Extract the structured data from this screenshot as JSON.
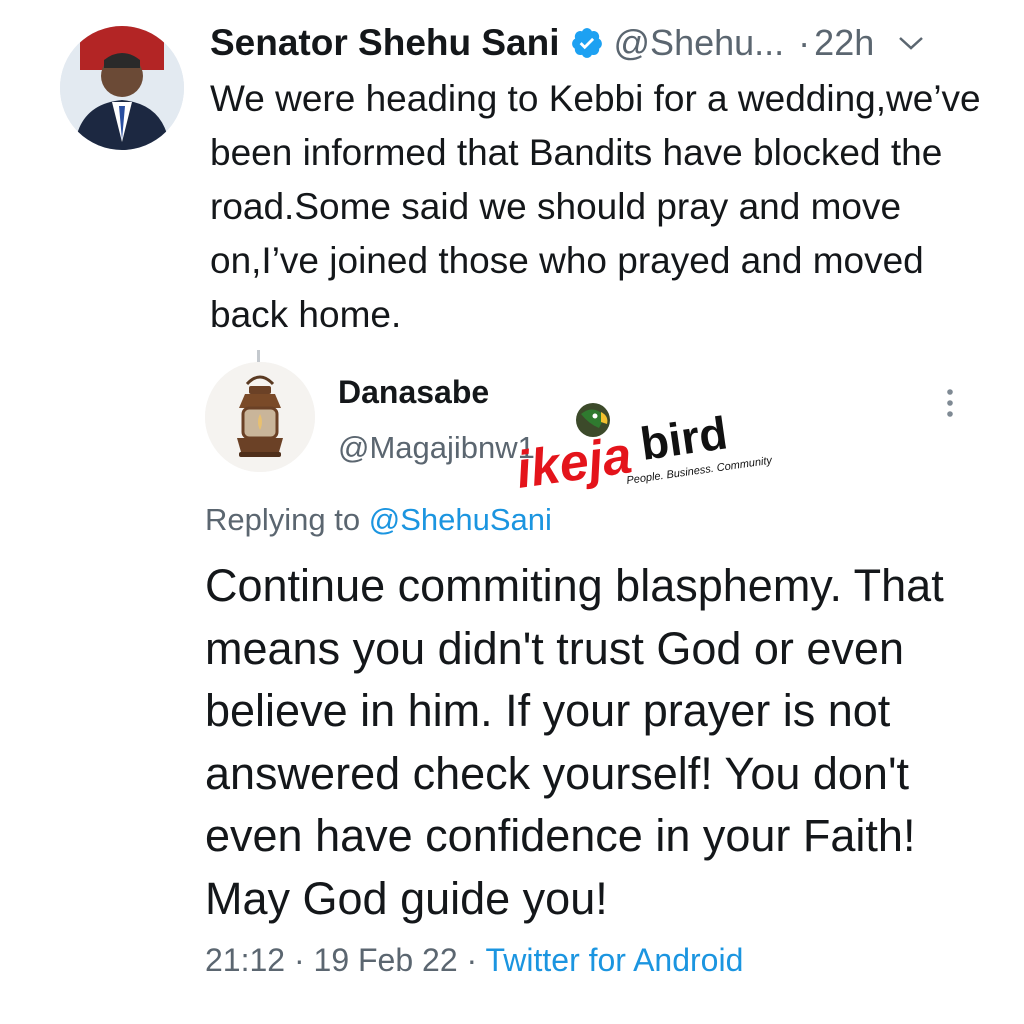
{
  "tweet": {
    "author_name": "Senator Shehu Sani",
    "handle": "@Shehu...",
    "separator": "·",
    "time_ago": "22h",
    "text": "We were heading to Kebbi for a wedding,we’ve been informed that Bandits have blocked the road.Some said we should pray and move on,I’ve joined those who prayed and moved back home."
  },
  "reply": {
    "author_name": "Danasabe",
    "handle": "@Magajibnw1",
    "replying_prefix": "Replying to",
    "replying_to": "@ShehuSani",
    "text": "Continue commiting blasphemy. That means you didn't trust God or even believe in him. If your prayer is not answered check yourself! You don't even have confidence in your Faith! May God guide you!",
    "timestamp": "21:12 · 19 Feb 22 ·",
    "source": "Twitter for Android"
  },
  "watermark": {
    "brand_part1": "ikeja",
    "brand_part2": "bird",
    "tagline": "People. Business. Community"
  },
  "colors": {
    "text": "#14171a",
    "secondary": "#5b6670",
    "link": "#1b95e0",
    "watermark_red": "#e4141b",
    "watermark_dark": "#111111"
  },
  "icons": [
    "verified-badge-icon",
    "chevron-down-icon",
    "more-vertical-icon"
  ]
}
